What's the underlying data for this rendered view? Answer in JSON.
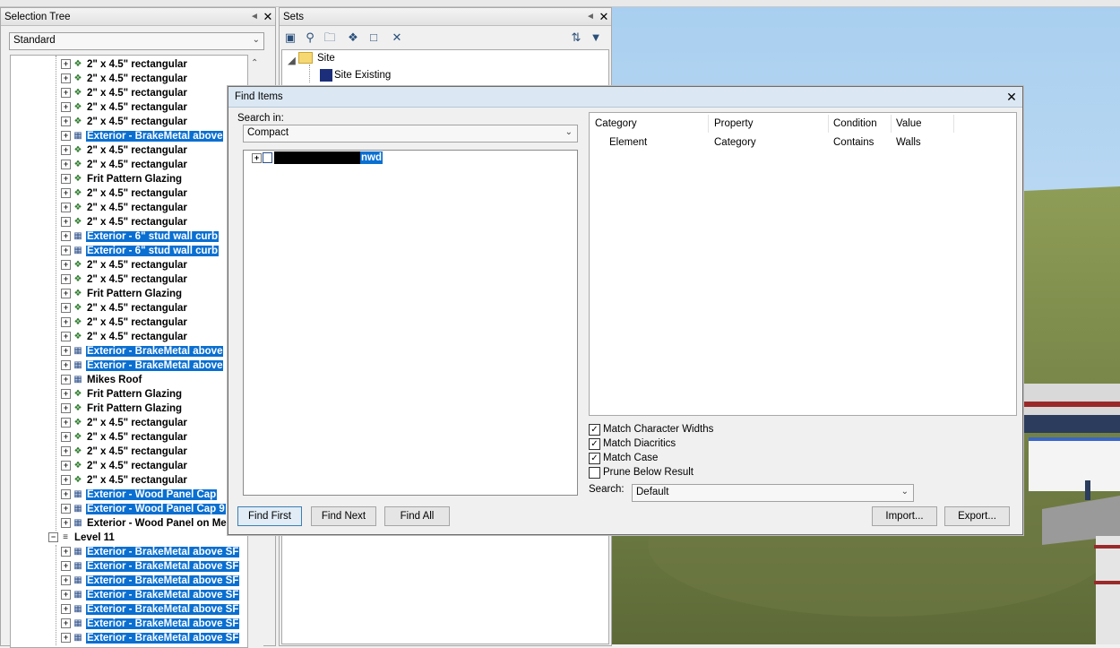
{
  "selection_tree": {
    "title": "Selection Tree",
    "combo_value": "Standard",
    "rows": [
      {
        "label": "2\" x 4.5\" rectangular",
        "icon": "shape-icon",
        "hl": false
      },
      {
        "label": "2\" x 4.5\" rectangular",
        "icon": "shape-icon",
        "hl": false
      },
      {
        "label": "2\" x 4.5\" rectangular",
        "icon": "shape-icon",
        "hl": false
      },
      {
        "label": "2\" x 4.5\" rectangular",
        "icon": "shape-icon",
        "hl": false
      },
      {
        "label": "2\" x 4.5\" rectangular",
        "icon": "shape-icon",
        "hl": false
      },
      {
        "label": "Exterior - BrakeMetal above",
        "icon": "composite-icon",
        "hl": true
      },
      {
        "label": "2\" x 4.5\" rectangular",
        "icon": "shape-icon",
        "hl": false
      },
      {
        "label": "2\" x 4.5\" rectangular",
        "icon": "shape-icon",
        "hl": false
      },
      {
        "label": "Frit Pattern Glazing",
        "icon": "shape-icon",
        "hl": false
      },
      {
        "label": "2\" x 4.5\" rectangular",
        "icon": "shape-icon",
        "hl": false
      },
      {
        "label": "2\" x 4.5\" rectangular",
        "icon": "shape-icon",
        "hl": false
      },
      {
        "label": "2\" x 4.5\" rectangular",
        "icon": "shape-icon",
        "hl": false
      },
      {
        "label": "Exterior - 6\" stud wall curb",
        "icon": "composite-icon",
        "hl": true
      },
      {
        "label": "Exterior - 6\" stud wall curb",
        "icon": "composite-icon",
        "hl": true
      },
      {
        "label": "2\" x 4.5\" rectangular",
        "icon": "shape-icon",
        "hl": false
      },
      {
        "label": "2\" x 4.5\" rectangular",
        "icon": "shape-icon",
        "hl": false
      },
      {
        "label": "Frit Pattern Glazing",
        "icon": "shape-icon",
        "hl": false
      },
      {
        "label": "2\" x 4.5\" rectangular",
        "icon": "shape-icon",
        "hl": false
      },
      {
        "label": "2\" x 4.5\" rectangular",
        "icon": "shape-icon",
        "hl": false
      },
      {
        "label": "2\" x 4.5\" rectangular",
        "icon": "shape-icon",
        "hl": false
      },
      {
        "label": "Exterior - BrakeMetal above",
        "icon": "composite-icon",
        "hl": true
      },
      {
        "label": "Exterior - BrakeMetal above",
        "icon": "composite-icon",
        "hl": true
      },
      {
        "label": "Mikes Roof",
        "icon": "composite-icon",
        "hl": false
      },
      {
        "label": "Frit Pattern Glazing",
        "icon": "shape-icon",
        "hl": false
      },
      {
        "label": "Frit Pattern Glazing",
        "icon": "shape-icon",
        "hl": false
      },
      {
        "label": "2\" x 4.5\" rectangular",
        "icon": "shape-icon",
        "hl": false
      },
      {
        "label": "2\" x 4.5\" rectangular",
        "icon": "shape-icon",
        "hl": false
      },
      {
        "label": "2\" x 4.5\" rectangular",
        "icon": "shape-icon",
        "hl": false
      },
      {
        "label": "2\" x 4.5\" rectangular",
        "icon": "shape-icon",
        "hl": false
      },
      {
        "label": "2\" x 4.5\" rectangular",
        "icon": "shape-icon",
        "hl": false
      },
      {
        "label": "Exterior - Wood Panel Cap",
        "icon": "composite-icon",
        "hl": true
      },
      {
        "label": "Exterior - Wood Panel Cap 9",
        "icon": "composite-icon",
        "hl": true
      },
      {
        "label": "Exterior - Wood Panel on Me",
        "icon": "composite-icon",
        "hl": false
      }
    ],
    "level": {
      "label": "Level 11",
      "icon": "layer-icon"
    },
    "level_rows": [
      {
        "label": "Exterior - BrakeMetal above SF",
        "icon": "composite-icon",
        "hl": true
      },
      {
        "label": "Exterior - BrakeMetal above SF",
        "icon": "composite-icon",
        "hl": true
      },
      {
        "label": "Exterior - BrakeMetal above SF",
        "icon": "composite-icon",
        "hl": true
      },
      {
        "label": "Exterior - BrakeMetal above SF",
        "icon": "composite-icon",
        "hl": true
      },
      {
        "label": "Exterior - BrakeMetal above SF",
        "icon": "composite-icon",
        "hl": true
      },
      {
        "label": "Exterior - BrakeMetal above SF",
        "icon": "composite-icon",
        "hl": true
      },
      {
        "label": "Exterior - BrakeMetal above SF",
        "icon": "composite-icon",
        "hl": true
      }
    ]
  },
  "sets": {
    "title": "Sets",
    "toolbar_icons": [
      "save-selection-icon",
      "save-search-icon",
      "new-folder-icon",
      "duplicate-icon",
      "add-comment-icon",
      "delete-icon",
      "sort-icon",
      "import-export-icon"
    ],
    "tree": {
      "root": "Site",
      "child": "Site Existing"
    }
  },
  "dialog": {
    "title": "Find Items",
    "search_in_label": "Search in:",
    "search_in_value": "Compact",
    "tree_item_suffix": "nwd",
    "criteria_headers": [
      "Category",
      "Property",
      "Condition",
      "Value"
    ],
    "criteria_rows": [
      [
        "Element",
        "Category",
        "Contains",
        "Walls"
      ]
    ],
    "options": [
      {
        "label": "Match Character Widths",
        "checked": true
      },
      {
        "label": "Match Diacritics",
        "checked": true
      },
      {
        "label": "Match Case",
        "checked": true
      },
      {
        "label": "Prune Below Result",
        "checked": false
      }
    ],
    "search_label": "Search:",
    "search_value": "Default",
    "buttons": {
      "find_first": "Find First",
      "find_next": "Find Next",
      "find_all": "Find All",
      "import": "Import...",
      "export": "Export..."
    }
  },
  "colors": {
    "highlight": "#0a6fd1",
    "sky": "#a8d0ee",
    "grass": "#7f8f4a"
  }
}
